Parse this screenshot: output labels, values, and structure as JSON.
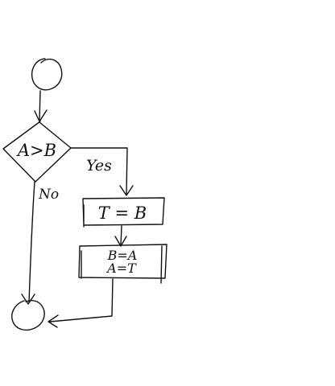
{
  "flowchart": {
    "decision": "A>B",
    "yes_label": "Yes",
    "no_label": "No",
    "swap_step": "T = B",
    "assign_line1": "B=A",
    "assign_line2": "A=T"
  },
  "colors": {
    "ink": "#111111",
    "background": "#ffffff"
  }
}
